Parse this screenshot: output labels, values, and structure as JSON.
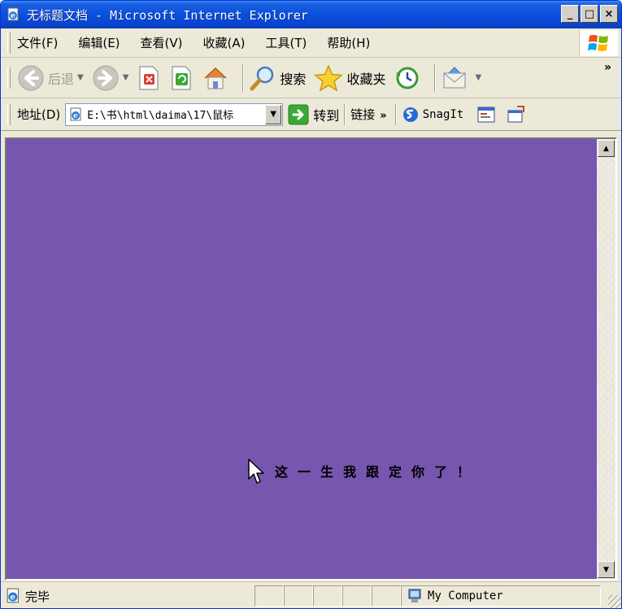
{
  "window": {
    "title": "无标题文档 - Microsoft Internet Explorer",
    "minimize_label": "_",
    "maximize_label": "□",
    "close_label": "×"
  },
  "menubar": {
    "items": [
      {
        "label": "文件(F)"
      },
      {
        "label": "编辑(E)"
      },
      {
        "label": "查看(V)"
      },
      {
        "label": "收藏(A)"
      },
      {
        "label": "工具(T)"
      },
      {
        "label": "帮助(H)"
      }
    ]
  },
  "toolbar": {
    "back_label": "后退",
    "search_label": "搜索",
    "favorites_label": "收藏夹",
    "more_label": "»"
  },
  "addressbar": {
    "label": "地址(D)",
    "url": "E:\\书\\html\\daima\\17\\鼠标",
    "go_label": "转到",
    "links_label": "链接",
    "links_more": "»",
    "snagit_label": "SnagIt"
  },
  "page": {
    "background": "#7656ae",
    "message": "这一生我跟定你了！"
  },
  "statusbar": {
    "status_text": "完毕",
    "zone_label": "My Computer"
  },
  "colors": {
    "titlebar": "#0a52df",
    "chrome": "#ece9d8",
    "page_background": "#7656ae"
  }
}
